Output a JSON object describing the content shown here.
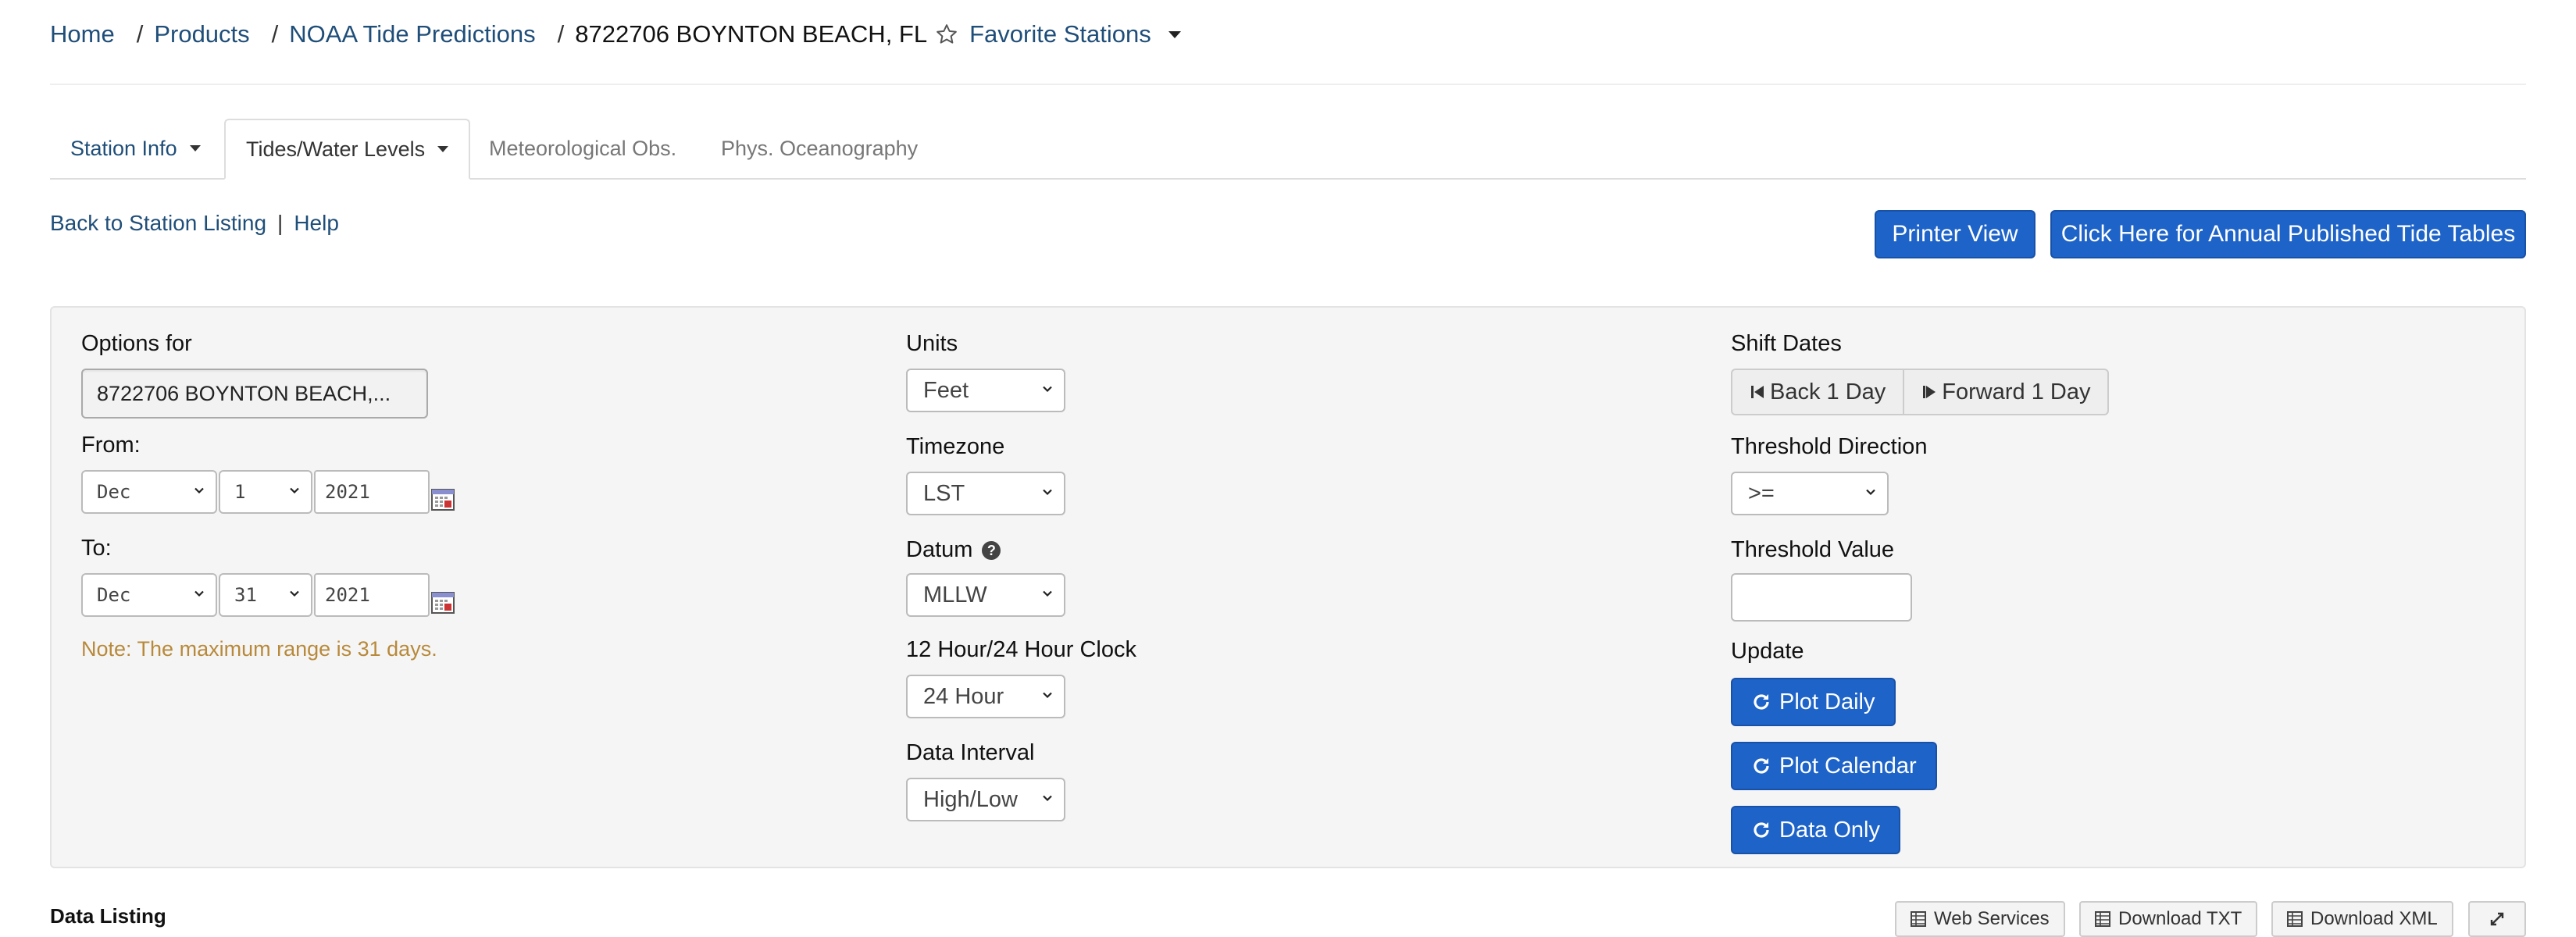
{
  "breadcrumb": {
    "items": [
      "Home",
      "Products",
      "NOAA Tide Predictions"
    ],
    "current": "8722706 BOYNTON BEACH, FL",
    "favorites": "Favorite Stations"
  },
  "tabs": [
    {
      "label": "Station Info"
    },
    {
      "label": "Tides/Water Levels"
    },
    {
      "label": "Meteorological Obs."
    },
    {
      "label": "Phys. Oceanography"
    }
  ],
  "links": {
    "back": "Back to Station Listing",
    "help": "Help",
    "separator": "|"
  },
  "buttons": {
    "printer": "Printer View",
    "annual": "Click Here for Annual Published Tide Tables"
  },
  "options": {
    "options_for_label": "Options for",
    "station": "8722706 BOYNTON BEACH,...",
    "from_label": "From:",
    "from": {
      "month": "Dec",
      "day": "1",
      "year": "2021"
    },
    "to_label": "To:",
    "to": {
      "month": "Dec",
      "day": "31",
      "year": "2021"
    },
    "note": "Note: The maximum range is 31 days.",
    "units_label": "Units",
    "units": "Feet",
    "timezone_label": "Timezone",
    "timezone": "LST",
    "datum_label": "Datum",
    "datum": "MLLW",
    "clock_label": "12 Hour/24 Hour Clock",
    "clock": "24 Hour",
    "interval_label": "Data Interval",
    "interval": "High/Low",
    "shift_label": "Shift Dates",
    "back_day": "Back 1 Day",
    "forward_day": "Forward 1 Day",
    "threshold_dir_label": "Threshold Direction",
    "threshold_dir": ">=",
    "threshold_val_label": "Threshold Value",
    "threshold_val": "",
    "update_label": "Update",
    "plot_daily": "Plot Daily",
    "plot_calendar": "Plot Calendar",
    "data_only": "Data Only"
  },
  "data_listing": {
    "title": "Data Listing",
    "web_services": "Web Services",
    "download_txt": "Download TXT",
    "download_xml": "Download XML"
  },
  "colors": {
    "primary": "#1e63c8",
    "link": "#1f4e79",
    "note": "#b8893a",
    "panel_bg": "#f5f5f5"
  }
}
